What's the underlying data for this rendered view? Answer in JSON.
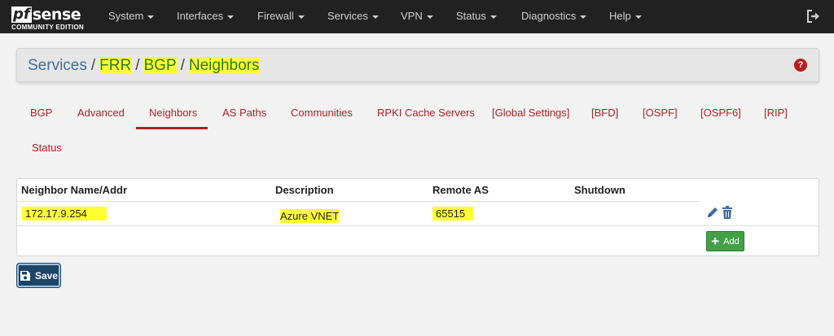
{
  "brand": {
    "logo_pf": "pf",
    "logo_sense": "sense",
    "edition": "COMMUNITY EDITION"
  },
  "nav": {
    "items": [
      {
        "label": "System"
      },
      {
        "label": "Interfaces"
      },
      {
        "label": "Firewall"
      },
      {
        "label": "Services"
      },
      {
        "label": "VPN"
      },
      {
        "label": "Status"
      },
      {
        "label": "Diagnostics"
      },
      {
        "label": "Help"
      }
    ],
    "logout_icon": "logout-icon"
  },
  "breadcrumb": {
    "parts": [
      "Services",
      "FRR",
      "BGP",
      "Neighbors"
    ],
    "separator": "/",
    "help_label": "?"
  },
  "tabs": {
    "items": [
      {
        "label": "BGP"
      },
      {
        "label": "Advanced"
      },
      {
        "label": "Neighbors"
      },
      {
        "label": "AS Paths"
      },
      {
        "label": "Communities"
      },
      {
        "label": "RPKI Cache Servers"
      },
      {
        "label": "[Global Settings]"
      },
      {
        "label": "[BFD]"
      },
      {
        "label": "[OSPF]"
      },
      {
        "label": "[OSPF6]"
      },
      {
        "label": "[RIP]"
      },
      {
        "label": "Status"
      }
    ],
    "active": "Neighbors"
  },
  "table": {
    "headers": [
      "Neighbor Name/Addr",
      "Description",
      "Remote AS",
      "Shutdown"
    ],
    "rows": [
      {
        "neighbor": "172.17.9.254",
        "description": "Azure VNET",
        "remote_as": "65515",
        "shutdown": ""
      }
    ],
    "add_label": "Add"
  },
  "save_label": "Save",
  "colors": {
    "navbar": "#212121",
    "tab_text": "#b22222",
    "highlight": "#ffff33",
    "add_button": "#43a047",
    "save_button": "#1e4466",
    "help_icon": "#b71c1c"
  }
}
